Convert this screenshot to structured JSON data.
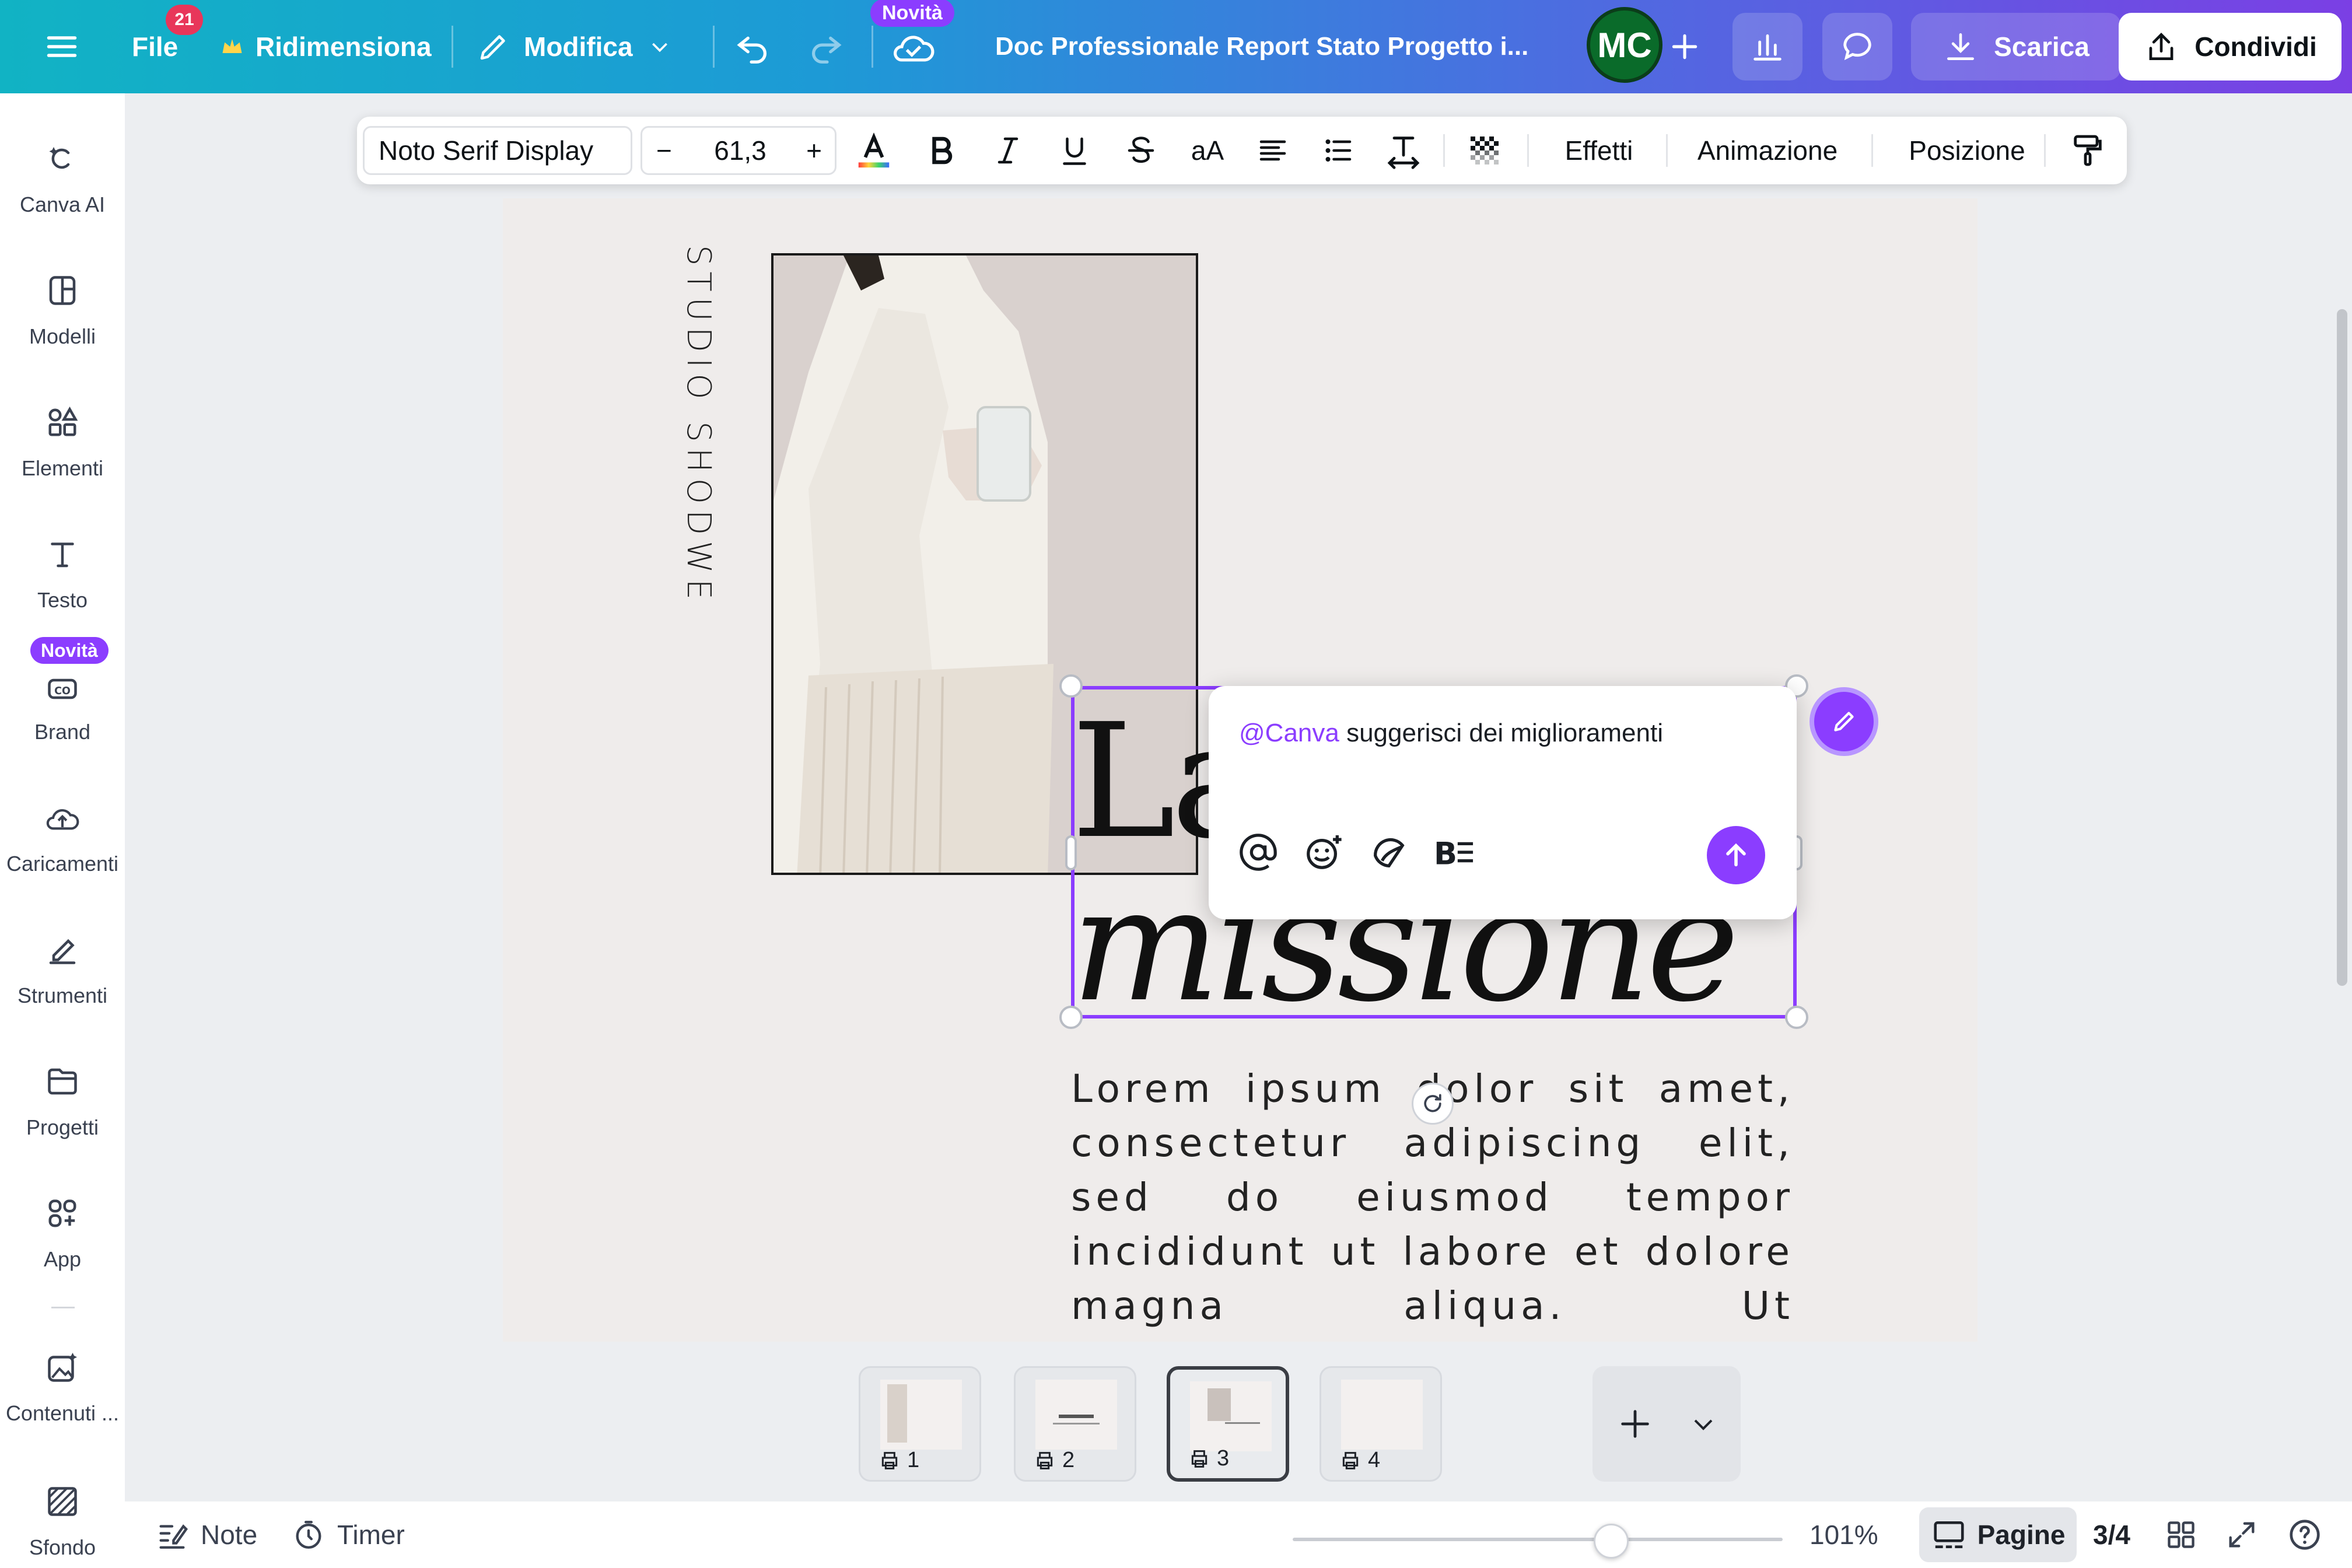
{
  "topbar": {
    "file_label": "File",
    "file_badge": "21",
    "resize_label": "Ridimensiona",
    "edit_label": "Modifica",
    "new_badge": "Novità",
    "doc_title": "Doc Professionale Report Stato Progetto i...",
    "avatar_initials": "MC",
    "download_label": "Scarica",
    "share_label": "Condividi"
  },
  "sidebar": {
    "items": [
      {
        "label": "Canva AI",
        "icon": "canva-ai-icon"
      },
      {
        "label": "Modelli",
        "icon": "templates-icon"
      },
      {
        "label": "Elementi",
        "icon": "elements-icon"
      },
      {
        "label": "Testo",
        "icon": "text-icon"
      },
      {
        "label": "Brand",
        "icon": "brand-icon"
      },
      {
        "label": "Caricamenti",
        "icon": "uploads-icon"
      },
      {
        "label": "Strumenti",
        "icon": "tools-icon"
      },
      {
        "label": "Progetti",
        "icon": "projects-icon"
      },
      {
        "label": "App",
        "icon": "apps-icon"
      },
      {
        "label": "Contenuti ...",
        "icon": "magic-media-icon"
      },
      {
        "label": "Sfondo",
        "icon": "background-icon"
      }
    ],
    "brand_badge": "Novità"
  },
  "format_toolbar": {
    "font_name": "Noto Serif Display",
    "font_size": "61,3",
    "minus": "−",
    "plus": "+",
    "case_label": "aA",
    "effects_label": "Effetti",
    "animation_label": "Animazione",
    "position_label": "Posizione"
  },
  "canvas": {
    "vertical_text": "STUDIO SHODWE",
    "title_line1": "La",
    "title_line2": "missione",
    "body_text": "Lorem ipsum dolor sit amet, consectetur adipiscing elit, sed do eiusmod tempor incididunt ut labore et dolore magna aliqua. Ut"
  },
  "comment": {
    "mention": "@Canva",
    "text": " suggerisci dei miglioramenti"
  },
  "thumbnails": [
    {
      "num": "1"
    },
    {
      "num": "2"
    },
    {
      "num": "3"
    },
    {
      "num": "4"
    }
  ],
  "bottombar": {
    "notes_label": "Note",
    "timer_label": "Timer",
    "zoom_value": "101%",
    "zoom_fraction": 0.65,
    "pages_label": "Pagine",
    "page_count": "3/4"
  },
  "colors": {
    "accent": "#8b3dff",
    "topbar_start": "#11b3c4",
    "topbar_end": "#7b3fe4"
  }
}
